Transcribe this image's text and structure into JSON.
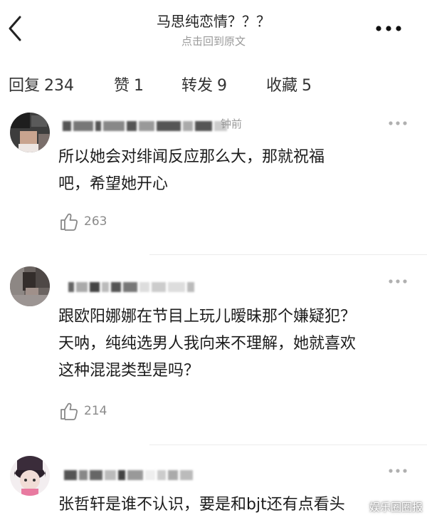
{
  "header": {
    "title": "马思纯恋情？？？",
    "subtitle": "点击回到原文"
  },
  "tabs": [
    {
      "label": "回复",
      "count": "234"
    },
    {
      "label": "赞",
      "count": "1"
    },
    {
      "label": "转发",
      "count": "9"
    },
    {
      "label": "收藏",
      "count": "5"
    }
  ],
  "comments": [
    {
      "time": "钟前",
      "text_line1": "所以她会对绯闻反应那么大，那就祝福",
      "text_line2": "吧，希望她开心",
      "likes": "263"
    },
    {
      "time": "",
      "text_line1": "跟欧阳娜娜在节目上玩儿暧昧那个嫌疑犯？",
      "text_line2": "天呐，纯纯选男人我向来不理解，她就喜欢",
      "text_line3": "这种混混类型是吗？",
      "likes": "214"
    },
    {
      "time": "",
      "text_line1": "张哲轩是谁不认识，要是和bjt还有点看头"
    }
  ],
  "watermark": "娱乐圈圈报",
  "colors": {
    "text_primary": "#1c1c1c",
    "text_secondary": "#9a9a9a",
    "divider": "#ececec"
  },
  "icons": {
    "back": "chevron-left-icon",
    "more": "more-horizontal-icon",
    "like": "thumb-up-icon"
  }
}
